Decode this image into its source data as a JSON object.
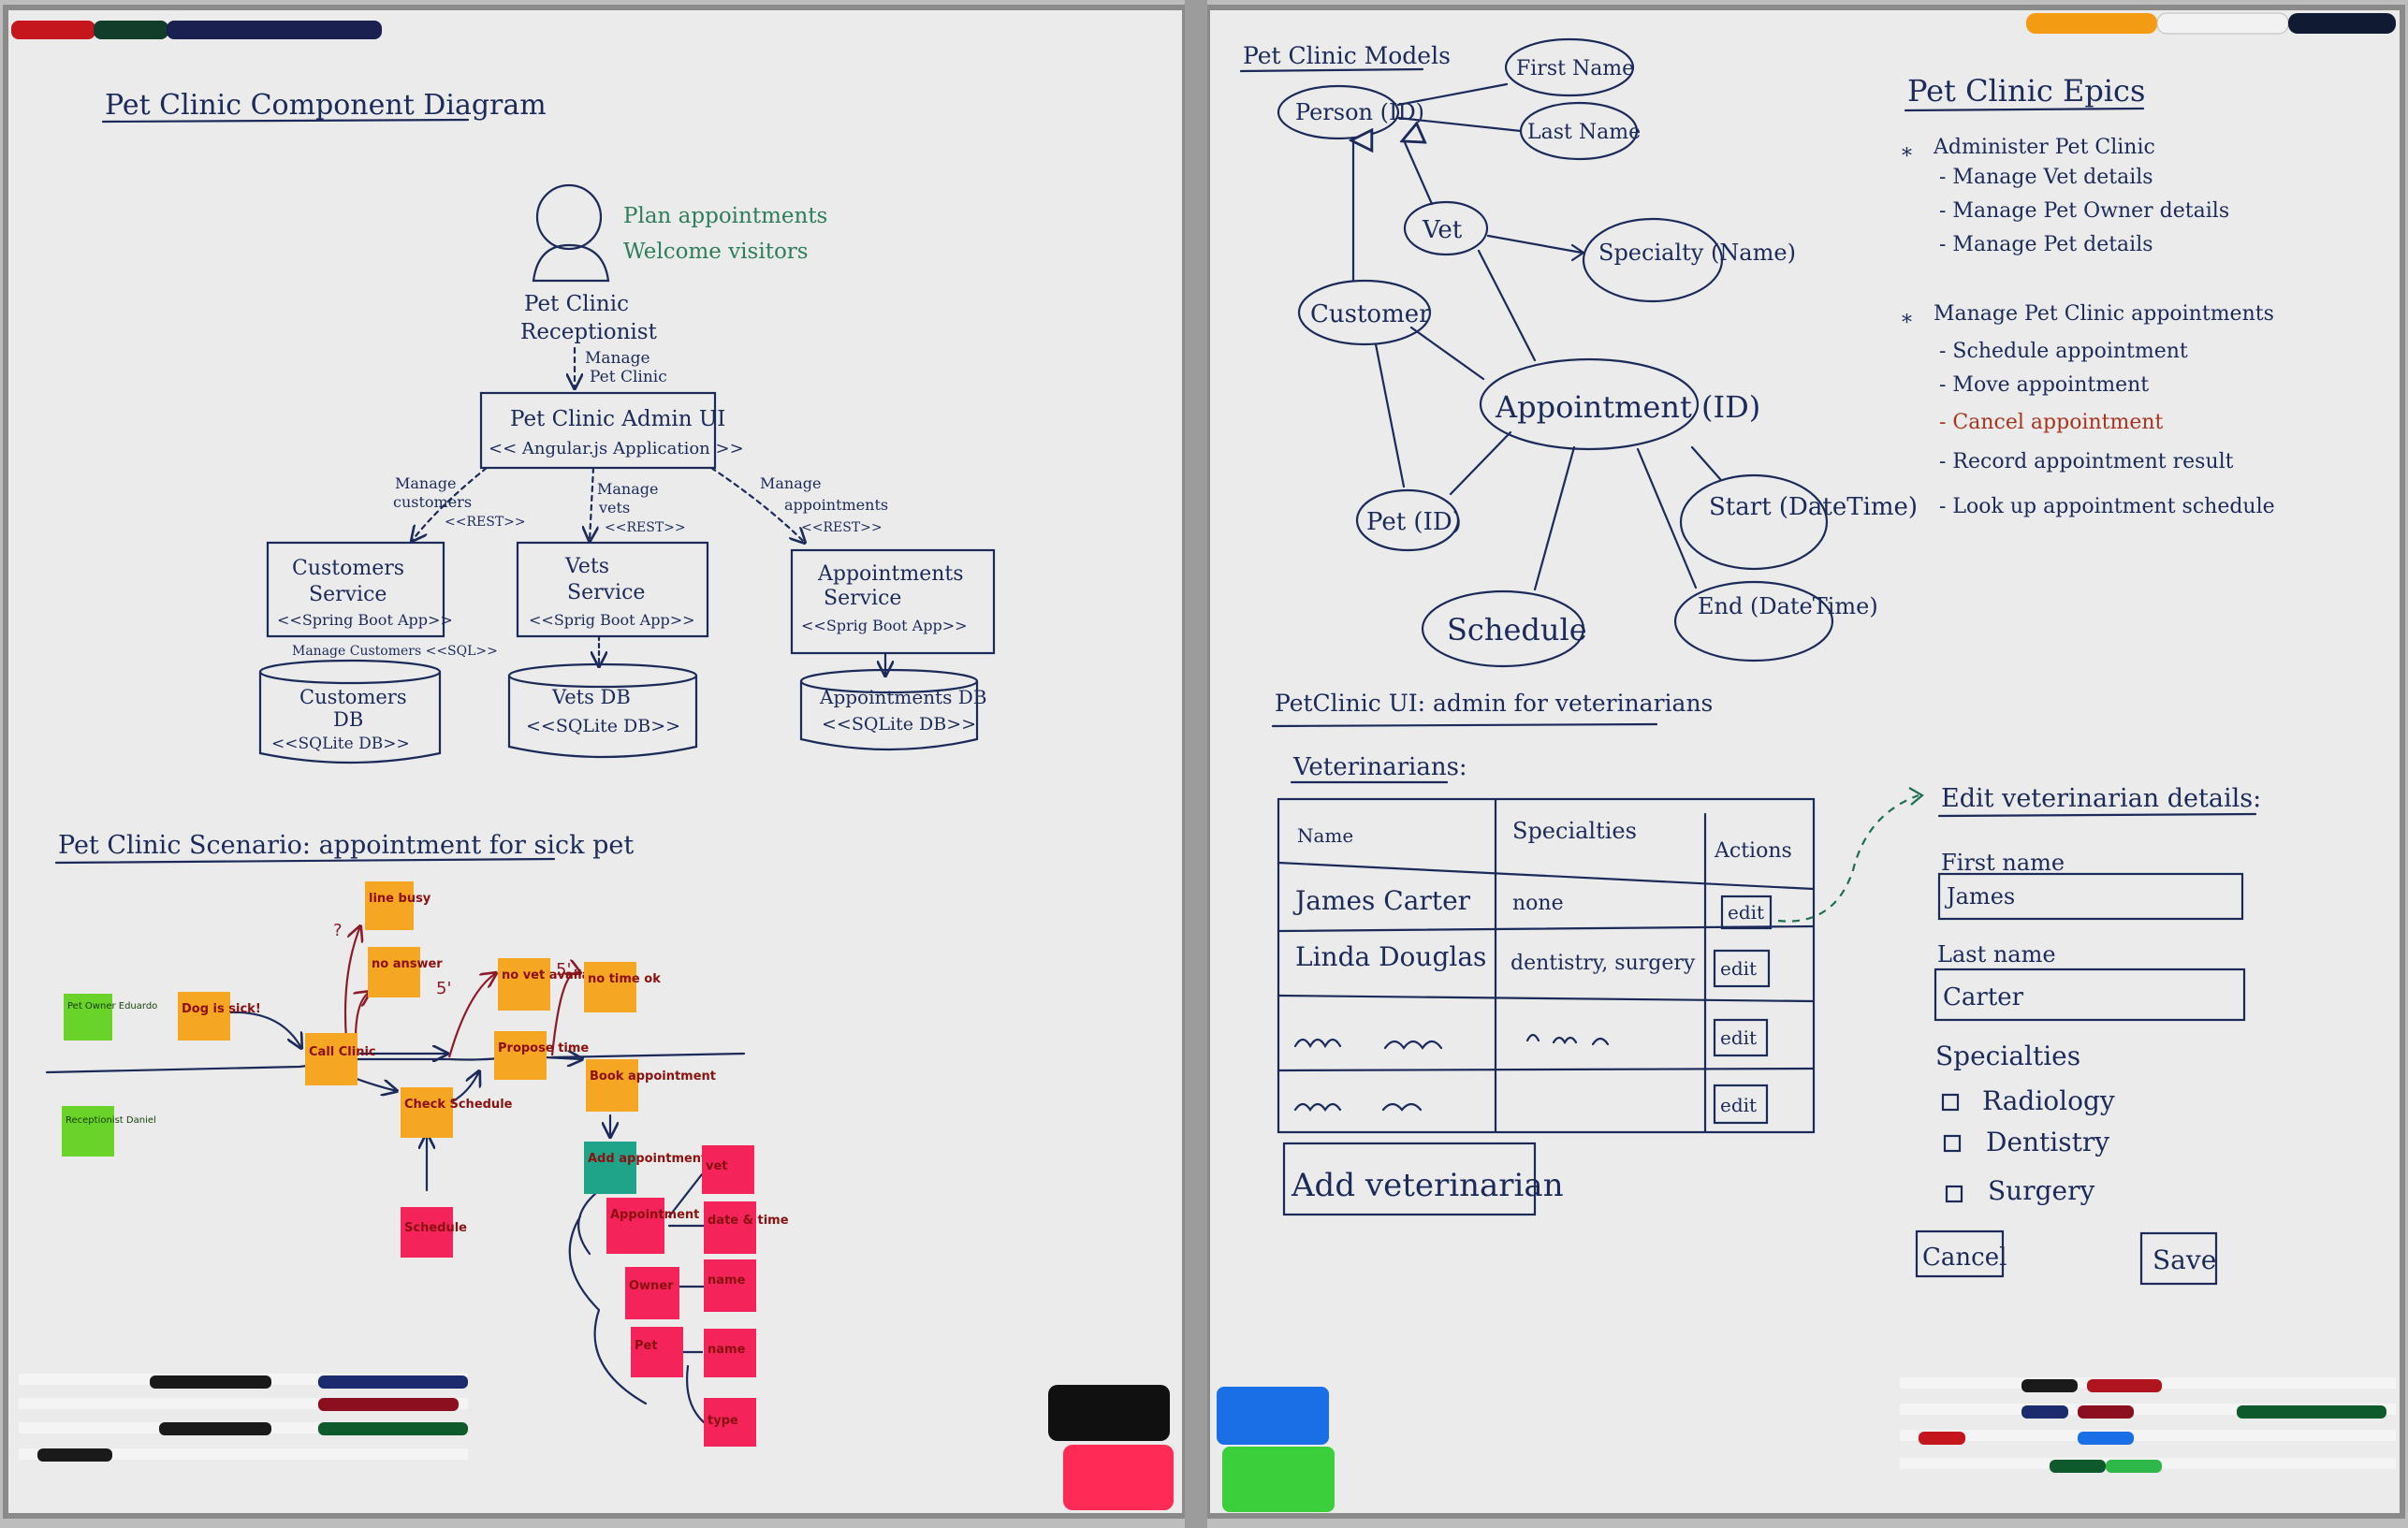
{
  "colors": {
    "board": "#ebebeb",
    "frame": "#8a8a8a",
    "ink": "#1c2a5a",
    "green_ink": "#2e7d5b",
    "red_ink": "#a8341f",
    "sticky_orange": "#f5a623",
    "sticky_green": "#6ad32a",
    "sticky_pink": "#f4245a",
    "sticky_teal": "#1fa48a"
  },
  "left_board": {
    "component_diagram": {
      "title": "Pet Clinic Component Diagram",
      "actor_name_line1": "Pet Clinic",
      "actor_name_line2": "Receptionist",
      "actor_goals": [
        "Plan appointments",
        "Welcome visitors"
      ],
      "manage_label_line1": "Manage",
      "manage_label_line2": "Pet Clinic",
      "admin_ui_line1": "Pet Clinic Admin UI",
      "admin_ui_line2": "<< Angular.js Application >>",
      "services": [
        {
          "arrow_line1": "Manage",
          "arrow_line2": "customers",
          "arrow_proto": "<<REST>>",
          "line1": "Customers",
          "line2": "Service",
          "line3": "<<Spring Boot App>>",
          "db_line1": "Customers",
          "db_line2": "DB",
          "db_line3": "<<SQLite DB>>"
        },
        {
          "arrow_line1": "Manage",
          "arrow_line2": "vets",
          "arrow_proto": "<<REST>>",
          "line1": "Vets",
          "line2": "Service",
          "line3": "<<Sprig Boot App>>",
          "db_line1": "Vets DB",
          "db_line2": "<<SQLite DB>>",
          "db_line3": ""
        },
        {
          "arrow_line1": "Manage",
          "arrow_line2": "appointments",
          "arrow_proto": "<<REST>>",
          "line1": "Appointments",
          "line2": "Service",
          "line3": "<<Sprig Boot App>>",
          "db_line1": "Appointments DB",
          "db_line2": "<<SQLite DB>>",
          "db_line3": ""
        }
      ],
      "customers_db_link": "Manage Customers <<SQL>>"
    },
    "scenario": {
      "title": "Pet Clinic Scenario: appointment for sick pet",
      "stickies": [
        {
          "id": "owner",
          "text": "Pet Owner Eduardo",
          "color": "green"
        },
        {
          "id": "receptionist",
          "text": "Receptionist Daniel",
          "color": "green"
        },
        {
          "id": "dog",
          "text": "Dog is sick!",
          "color": "orange"
        },
        {
          "id": "call",
          "text": "Call Clinic",
          "color": "orange"
        },
        {
          "id": "busy",
          "text": "line busy",
          "color": "orange"
        },
        {
          "id": "noanswer",
          "text": "no answer",
          "color": "orange"
        },
        {
          "id": "check",
          "text": "Check Schedule",
          "color": "orange"
        },
        {
          "id": "novet",
          "text": "no vet available",
          "color": "orange"
        },
        {
          "id": "propose",
          "text": "Propose time",
          "color": "orange"
        },
        {
          "id": "notime",
          "text": "no time ok",
          "color": "orange"
        },
        {
          "id": "book",
          "text": "Book appointment",
          "color": "orange"
        },
        {
          "id": "add",
          "text": "Add appointment",
          "color": "teal"
        },
        {
          "id": "schedule",
          "text": "Schedule",
          "color": "pink"
        },
        {
          "id": "appt",
          "text": "Appointment",
          "color": "pink"
        },
        {
          "id": "vet",
          "text": "vet",
          "color": "pink"
        },
        {
          "id": "datetime",
          "text": "date & time",
          "color": "pink"
        },
        {
          "id": "owner2",
          "text": "Owner",
          "color": "pink"
        },
        {
          "id": "name",
          "text": "name",
          "color": "pink"
        },
        {
          "id": "pet",
          "text": "Pet",
          "color": "pink"
        },
        {
          "id": "name2",
          "text": "name",
          "color": "pink"
        },
        {
          "id": "type",
          "text": "type",
          "color": "pink"
        }
      ],
      "question_marks": [
        "?",
        "5'",
        "5'"
      ]
    }
  },
  "right_board": {
    "models": {
      "title": "Pet Clinic Models",
      "entities": [
        "Person (ID)",
        "First Name",
        "Last Name",
        "Vet",
        "Specialty (Name)",
        "Customer",
        "Appointment (ID)",
        "Pet (ID)",
        "Start (DateTime)",
        "Schedule",
        "End (DateTime)"
      ]
    },
    "epics": {
      "title": "Pet Clinic Epics",
      "groups": [
        {
          "bullet": "*",
          "heading": "Administer Pet Clinic",
          "items": [
            "- Manage Vet details",
            "- Manage Pet Owner details",
            "- Manage Pet details"
          ]
        },
        {
          "bullet": "*",
          "heading": "Manage Pet Clinic appointments",
          "items": [
            "- Schedule appointment",
            "- Move appointment",
            "- Cancel appointment",
            "- Record appointment result",
            "- Look up appointment schedule"
          ]
        }
      ]
    },
    "ui_sketch": {
      "title": "PetClinic UI: admin for veterinarians",
      "list_heading": "Veterinarians:",
      "columns": [
        "Name",
        "Specialties",
        "Actions"
      ],
      "rows": [
        {
          "name": "James Carter",
          "specialties": "none",
          "action": "edit"
        },
        {
          "name": "Linda Douglas",
          "specialties": "dentistry, surgery",
          "action": "edit"
        },
        {
          "name": "",
          "specialties": "",
          "action": "edit"
        },
        {
          "name": "",
          "specialties": "",
          "action": "edit"
        }
      ],
      "add_button": "Add veterinarian",
      "edit_form": {
        "title": "Edit veterinarian details:",
        "first_name_label": "First name",
        "first_name_value": "James",
        "last_name_label": "Last name",
        "last_name_value": "Carter",
        "specialties_label": "Specialties",
        "specialties": [
          "Radiology",
          "Dentistry",
          "Surgery"
        ],
        "cancel": "Cancel",
        "save": "Save"
      }
    }
  }
}
